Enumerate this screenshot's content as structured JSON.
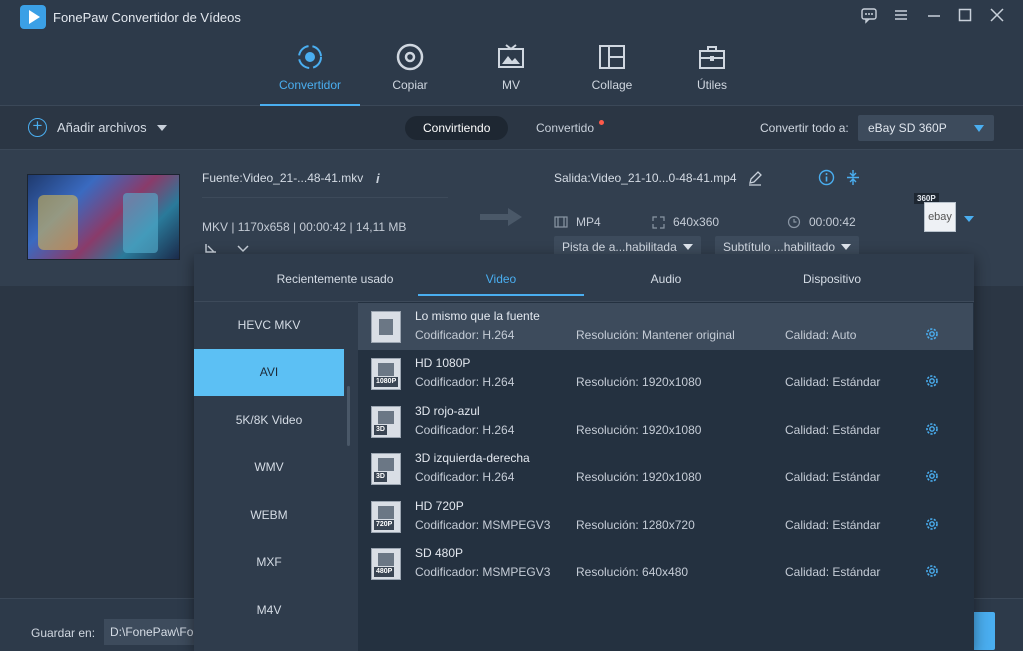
{
  "app": {
    "title": "FonePaw Convertidor de Vídeos"
  },
  "nav": {
    "tabs": [
      {
        "label": "Convertidor",
        "icon": "convert-icon"
      },
      {
        "label": "Copiar",
        "icon": "disc-icon"
      },
      {
        "label": "MV",
        "icon": "mv-icon"
      },
      {
        "label": "Collage",
        "icon": "collage-icon"
      },
      {
        "label": "Útiles",
        "icon": "toolbox-icon"
      }
    ]
  },
  "toolbar": {
    "add_files": "Añadir archivos",
    "converting": "Convirtiendo",
    "converted": "Convertido",
    "convert_all_label": "Convertir todo a:",
    "convert_all_value": "eBay SD 360P"
  },
  "file": {
    "source": "Fuente:Video_21-...48-41.mkv",
    "meta": "MKV | 1170x658 | 00:00:42 | 14,11 MB",
    "output": "Salida:Video_21-10...0-48-41.mp4",
    "out_format": "MP4",
    "out_resolution": "640x360",
    "out_duration": "00:00:42",
    "audio_track": "Pista de a...habilitada",
    "subtitle": "Subtítulo ...habilitado",
    "profile_badge": "360P",
    "profile_logo": "ebay"
  },
  "popup": {
    "tabs": [
      "Recientemente usado",
      "Video",
      "Audio",
      "Dispositivo"
    ],
    "active_tab": "Video",
    "formats": [
      "HEVC MKV",
      "AVI",
      "5K/8K Video",
      "WMV",
      "WEBM",
      "MXF",
      "M4V"
    ],
    "active_format": "AVI",
    "options": [
      {
        "name": "Lo mismo que la fuente",
        "codec": "Codificador: H.264",
        "resolution": "Resolución: Mantener original",
        "quality": "Calidad: Auto",
        "tag": ""
      },
      {
        "name": "HD 1080P",
        "codec": "Codificador: H.264",
        "resolution": "Resolución: 1920x1080",
        "quality": "Calidad: Estándar",
        "tag": "1080P"
      },
      {
        "name": "3D rojo-azul",
        "codec": "Codificador: H.264",
        "resolution": "Resolución: 1920x1080",
        "quality": "Calidad: Estándar",
        "tag": "3D"
      },
      {
        "name": "3D izquierda-derecha",
        "codec": "Codificador: H.264",
        "resolution": "Resolución: 1920x1080",
        "quality": "Calidad: Estándar",
        "tag": "3D"
      },
      {
        "name": "HD 720P",
        "codec": "Codificador: MSMPEGV3",
        "resolution": "Resolución: 1280x720",
        "quality": "Calidad: Estándar",
        "tag": "720P"
      },
      {
        "name": "SD 480P",
        "codec": "Codificador: MSMPEGV3",
        "resolution": "Resolución: 640x480",
        "quality": "Calidad: Estándar",
        "tag": "480P"
      }
    ]
  },
  "bottom": {
    "save_label": "Guardar en:",
    "save_path": "D:\\FonePaw\\Fo"
  },
  "colors": {
    "accent": "#4aaef0",
    "background": "#2b3644",
    "selected_format": "#5cc0f4",
    "notify_dot": "#ff5a4a"
  }
}
